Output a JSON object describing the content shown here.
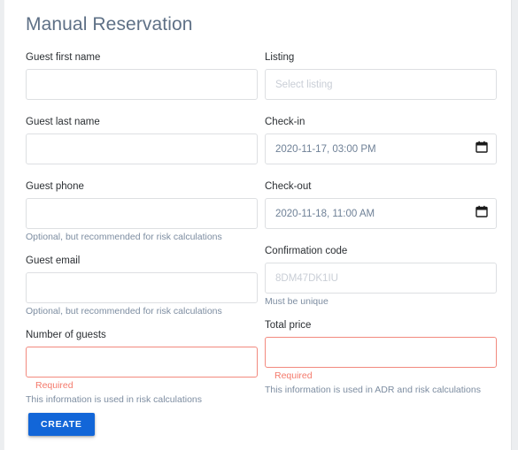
{
  "page": {
    "title": "Manual Reservation",
    "accent_color": "#1266d8",
    "error_color": "#f4796b",
    "title_color": "#5e7086",
    "background_color": "#eceef0",
    "card_color": "#ffffff"
  },
  "form": {
    "left_column": [
      {
        "name": "guest-first-name",
        "label": "Guest first name",
        "value": "",
        "placeholder": "",
        "error": "",
        "help": "",
        "icon": ""
      },
      {
        "name": "guest-last-name",
        "label": "Guest last name",
        "value": "",
        "placeholder": "",
        "error": "",
        "help": "",
        "icon": ""
      },
      {
        "name": "guest-phone",
        "label": "Guest phone",
        "value": "",
        "placeholder": "",
        "error": "",
        "help": "Optional, but recommended for risk calculations",
        "icon": ""
      },
      {
        "name": "guest-email",
        "label": "Guest email",
        "value": "",
        "placeholder": "",
        "error": "",
        "help": "Optional, but recommended for risk calculations",
        "icon": ""
      },
      {
        "name": "number-of-guests",
        "label": "Number of guests",
        "value": "",
        "placeholder": "",
        "error": "Required",
        "help": "This information is used in risk calculations",
        "icon": ""
      }
    ],
    "right_column": [
      {
        "name": "listing",
        "label": "Listing",
        "value": "",
        "placeholder": "Select listing",
        "error": "",
        "help": "",
        "icon": ""
      },
      {
        "name": "check-in",
        "label": "Check-in",
        "value": "2020-11-17, 03:00 PM",
        "placeholder": "",
        "error": "",
        "help": "",
        "icon": "calendar-icon"
      },
      {
        "name": "check-out",
        "label": "Check-out",
        "value": "2020-11-18, 11:00 AM",
        "placeholder": "",
        "error": "",
        "help": "",
        "icon": "calendar-icon"
      },
      {
        "name": "confirmation-code",
        "label": "Confirmation code",
        "value": "",
        "placeholder": "8DM47DK1IU",
        "error": "",
        "help": "Must be unique",
        "icon": ""
      },
      {
        "name": "total-price",
        "label": "Total price",
        "value": "",
        "placeholder": "",
        "error": "Required",
        "help": "This information is used in ADR and risk calculations",
        "icon": ""
      }
    ]
  },
  "actions": {
    "create_label": "CREATE"
  }
}
